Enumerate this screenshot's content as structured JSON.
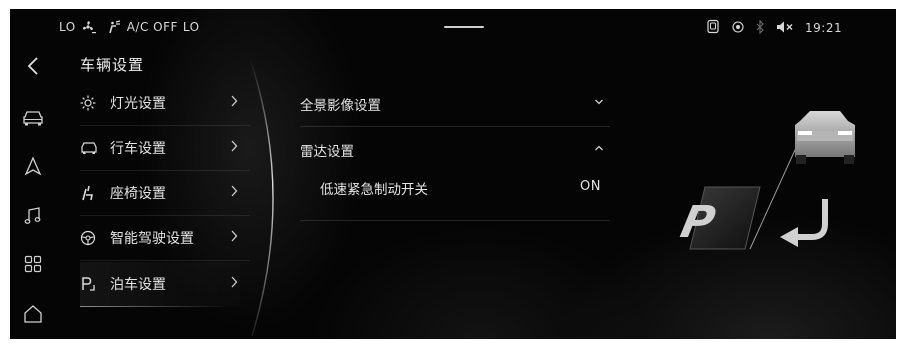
{
  "status_bar": {
    "left_text_1": "LO",
    "climate_text": "A/C OFF",
    "left_text_2": "LO",
    "time": "19:21"
  },
  "page": {
    "title": "车辆设置"
  },
  "menu": {
    "items": [
      {
        "label": "灯光设置",
        "icon": "light-icon"
      },
      {
        "label": "行车设置",
        "icon": "car-icon"
      },
      {
        "label": "座椅设置",
        "icon": "seat-icon"
      },
      {
        "label": "智能驾驶设置",
        "icon": "steering-wheel-icon"
      },
      {
        "label": "泊车设置",
        "icon": "parking-icon"
      }
    ],
    "selected_index": 4
  },
  "content": {
    "sections": [
      {
        "label": "全景影像设置",
        "expanded": false
      },
      {
        "label": "雷达设置",
        "expanded": true
      }
    ],
    "radar_setting": {
      "label": "低速紧急制动开关",
      "value": "ON"
    }
  },
  "colors": {
    "background": "#050505",
    "text": "#e6e6e6",
    "separator": "#2a2a2a"
  }
}
